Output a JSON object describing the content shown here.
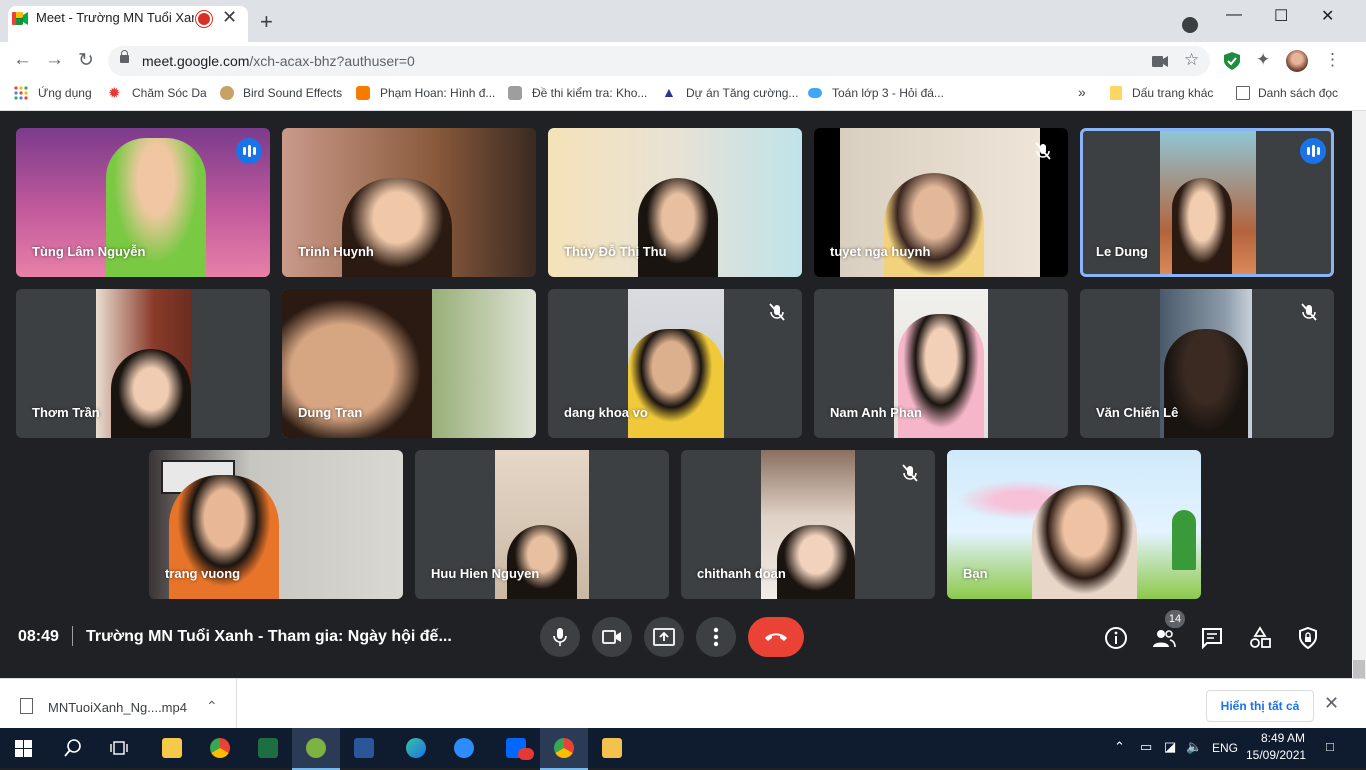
{
  "browser": {
    "tab_title": "Meet - Trường MN Tuổi Xanh",
    "new_tab": "+",
    "tab_close": "✕",
    "url_host": "meet.google.com",
    "url_path": "/xch-acax-bhz?authuser=0",
    "window_controls": {
      "minimize": "—",
      "maximize": "☐",
      "close": "✕"
    }
  },
  "bookmarks": [
    {
      "label": "Ứng dụng",
      "color": "#ea4335"
    },
    {
      "label": "Chăm Sóc Da",
      "color": "#e53935"
    },
    {
      "label": "Bird Sound Effects",
      "color": "#c8a165"
    },
    {
      "label": "Phạm Hoan: Hình đ...",
      "color": "#f57c00"
    },
    {
      "label": "Đề thi kiểm tra: Kho...",
      "color": "#9e9e9e"
    },
    {
      "label": "Dự án Tăng cường...",
      "color": "#283593"
    },
    {
      "label": "Toán lớp 3 - Hỏi đá...",
      "color": "#42a5f5"
    }
  ],
  "bookmarks_more": "»",
  "bookmarks_other": "Dấu trang khác",
  "reading_list": "Danh sách đọc",
  "participants": [
    {
      "name": "Tùng Lâm Nguyễn",
      "state": "speaking"
    },
    {
      "name": "Trinh Huynh",
      "state": "none"
    },
    {
      "name": "Thủy Đỗ Thị Thu",
      "state": "none"
    },
    {
      "name": "tuyet nga huynh",
      "state": "muted"
    },
    {
      "name": "Le Dung",
      "state": "speaking"
    },
    {
      "name": "Thơm Trần",
      "state": "none"
    },
    {
      "name": "Dung Tran",
      "state": "none"
    },
    {
      "name": "dang khoa vo",
      "state": "muted"
    },
    {
      "name": "Nam Anh Phan",
      "state": "none"
    },
    {
      "name": "Văn Chiến Lê",
      "state": "muted"
    },
    {
      "name": "trang vuong",
      "state": "none"
    },
    {
      "name": "Huu Hien Nguyen",
      "state": "none"
    },
    {
      "name": "chithanh doan",
      "state": "muted"
    },
    {
      "name": "Bạn",
      "state": "none"
    }
  ],
  "meeting": {
    "time": "08:49",
    "title": "Trường MN Tuổi Xanh - Tham gia: Ngày hội đế...",
    "participant_count": "14"
  },
  "downloads": {
    "file_name": "MNTuoiXanh_Ng....mp4",
    "show_all": "Hiển thị tất cả"
  },
  "taskbar": {
    "lang": "ENG",
    "time": "8:49 AM",
    "date": "15/09/2021"
  }
}
